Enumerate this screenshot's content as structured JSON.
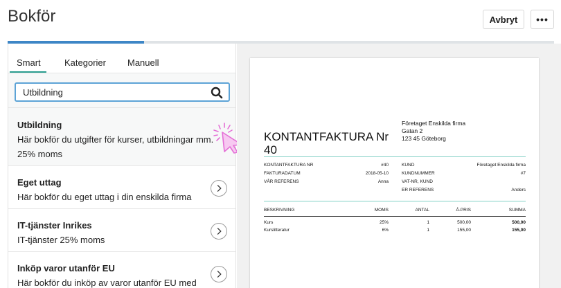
{
  "header": {
    "title": "Bokför",
    "cancel_label": "Avbryt",
    "more_label": "•••"
  },
  "progress": {
    "fraction": 0.25
  },
  "tabs": [
    {
      "label": "Smart",
      "active": true
    },
    {
      "label": "Kategorier",
      "active": false
    },
    {
      "label": "Manuell",
      "active": false
    }
  ],
  "search": {
    "value": "Utbildning"
  },
  "items": [
    {
      "title": "Utbildning",
      "desc": "Här bokför du utgifter för kurser, utbildningar mm.",
      "desc2": "25% moms"
    },
    {
      "title": "Eget uttag",
      "desc": "Här bokför du eget uttag i din enskilda firma"
    },
    {
      "title": "IT-tjänster Inrikes",
      "desc": "IT-tjänster 25% moms"
    },
    {
      "title": "Inköp varor utanför EU",
      "desc": "Här bokför du inköp av varor utanför EU med"
    }
  ],
  "invoice": {
    "title": "KONTANTFAKTURA Nr 40",
    "company_name": "Företaget Enskilda firma",
    "company_street": "Gatan 2",
    "company_city": "123 45 Göteborg",
    "meta_left": [
      {
        "label": "KONTANTFAKTURA NR",
        "value": "#40"
      },
      {
        "label": "FAKTURADATUM",
        "value": "2018-05-10"
      },
      {
        "label": "VÅR REFERENS",
        "value": "Anna"
      }
    ],
    "meta_right": [
      {
        "label": "KUND",
        "value": "Företaget Enskilda firma"
      },
      {
        "label": "KUNDNUMMER",
        "value": "#7"
      },
      {
        "label": "VAT-NR, KUND",
        "value": ""
      },
      {
        "label": "ER REFERENS",
        "value": "Anders"
      }
    ],
    "columns": {
      "desc": "BESKRIVNING",
      "vat": "MOMS",
      "qty": "ANTAL",
      "price": "Á-PRIS",
      "sum": "SUMMA"
    },
    "rows": [
      {
        "desc": "Kurs",
        "vat": "25%",
        "qty": "1",
        "price": "500,00",
        "sum": "500,00"
      },
      {
        "desc": "Kurslitteratur",
        "vat": "6%",
        "qty": "1",
        "price": "155,00",
        "sum": "155,00"
      }
    ]
  }
}
